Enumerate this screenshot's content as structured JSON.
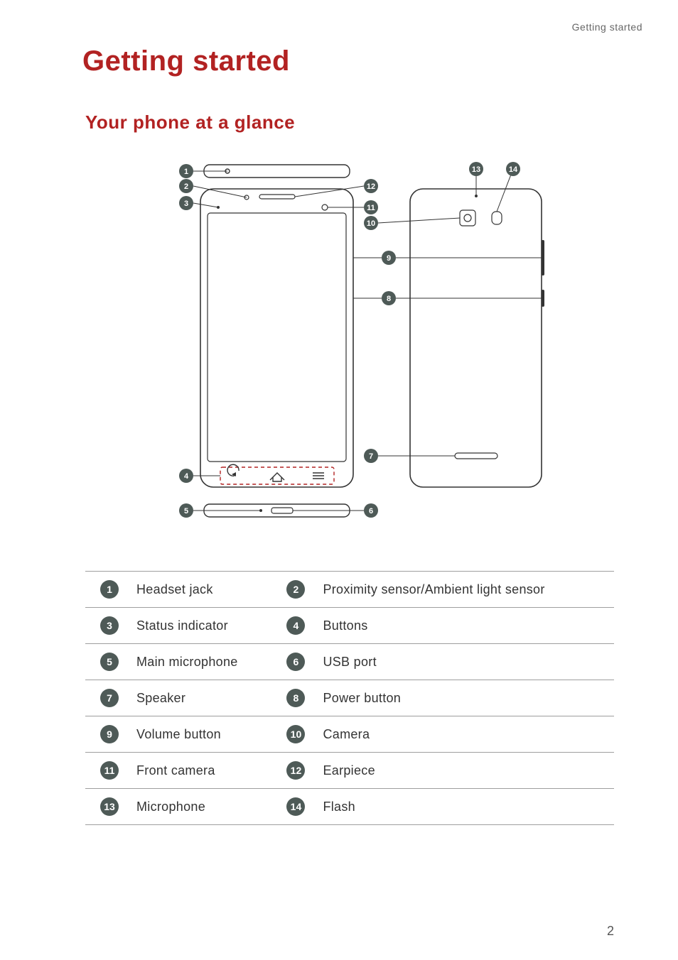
{
  "header": {
    "breadcrumb": "Getting started"
  },
  "title": "Getting started",
  "subtitle": "Your phone at a glance",
  "parts": [
    {
      "n": 1,
      "label": "Headset jack"
    },
    {
      "n": 2,
      "label": "Proximity sensor/Ambient light sensor"
    },
    {
      "n": 3,
      "label": "Status indicator"
    },
    {
      "n": 4,
      "label": "Buttons"
    },
    {
      "n": 5,
      "label": "Main microphone"
    },
    {
      "n": 6,
      "label": "USB port"
    },
    {
      "n": 7,
      "label": "Speaker"
    },
    {
      "n": 8,
      "label": "Power button"
    },
    {
      "n": 9,
      "label": "Volume button"
    },
    {
      "n": 10,
      "label": "Camera"
    },
    {
      "n": 11,
      "label": "Front camera"
    },
    {
      "n": 12,
      "label": "Earpiece"
    },
    {
      "n": 13,
      "label": "Microphone"
    },
    {
      "n": 14,
      "label": "Flash"
    }
  ],
  "page_number": "2"
}
